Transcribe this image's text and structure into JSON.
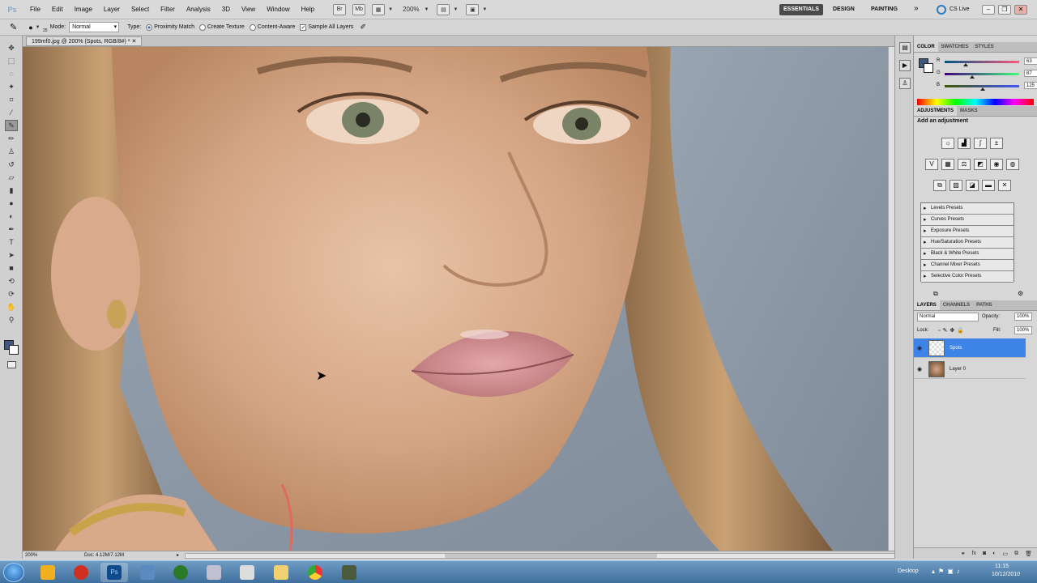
{
  "app": {
    "logo": "Ps"
  },
  "menu": [
    "File",
    "Edit",
    "Image",
    "Layer",
    "Select",
    "Filter",
    "Analysis",
    "3D",
    "View",
    "Window",
    "Help"
  ],
  "menubar_right": {
    "zoom": "200%",
    "workspaces": [
      "ESSENTIALS",
      "DESIGN",
      "PAINTING"
    ],
    "more": "»",
    "cs_live": "CS Live"
  },
  "options": {
    "mode_label": "Mode:",
    "mode_value": "Normal",
    "type_label": "Type:",
    "type_options": [
      "Proximity Match",
      "Create Texture",
      "Content-Aware"
    ],
    "type_selected": "Proximity Match",
    "sample_all_layers": "Sample All Layers",
    "brush_size": "25"
  },
  "document": {
    "tab_title": "199mf0.jpg @ 200% (Spots, RGB/8#) *",
    "zoom": "200%",
    "doc_info": "Doc: 4.12M/7.12M"
  },
  "panels": {
    "color_tabs": [
      "COLOR",
      "SWATCHES",
      "STYLES"
    ],
    "color": {
      "r_label": "R",
      "g_label": "G",
      "b_label": "B",
      "r": 63,
      "g": 87,
      "b": 125,
      "fg_color": "#3f577d"
    },
    "adjust_tabs": [
      "ADJUSTMENTS",
      "MASKS"
    ],
    "adjust_header": "Add an adjustment",
    "presets": [
      "Levels Presets",
      "Curves Presets",
      "Exposure Presets",
      "Hue/Saturation Presets",
      "Black & White Presets",
      "Channel Mixer Presets",
      "Selective Color Presets"
    ],
    "layers_tabs": [
      "LAYERS",
      "CHANNELS",
      "PATHS"
    ],
    "blend_mode": "Normal",
    "opacity_label": "Opacity:",
    "opacity": "100%",
    "lock_label": "Lock:",
    "fill_label": "Fill:",
    "fill": "100%",
    "layers": [
      {
        "name": "Spots",
        "selected": true
      },
      {
        "name": "Layer 0",
        "selected": false
      }
    ]
  },
  "taskbar": {
    "desktop": "Desktop",
    "time": "11:15",
    "date": "10/12/2010"
  }
}
